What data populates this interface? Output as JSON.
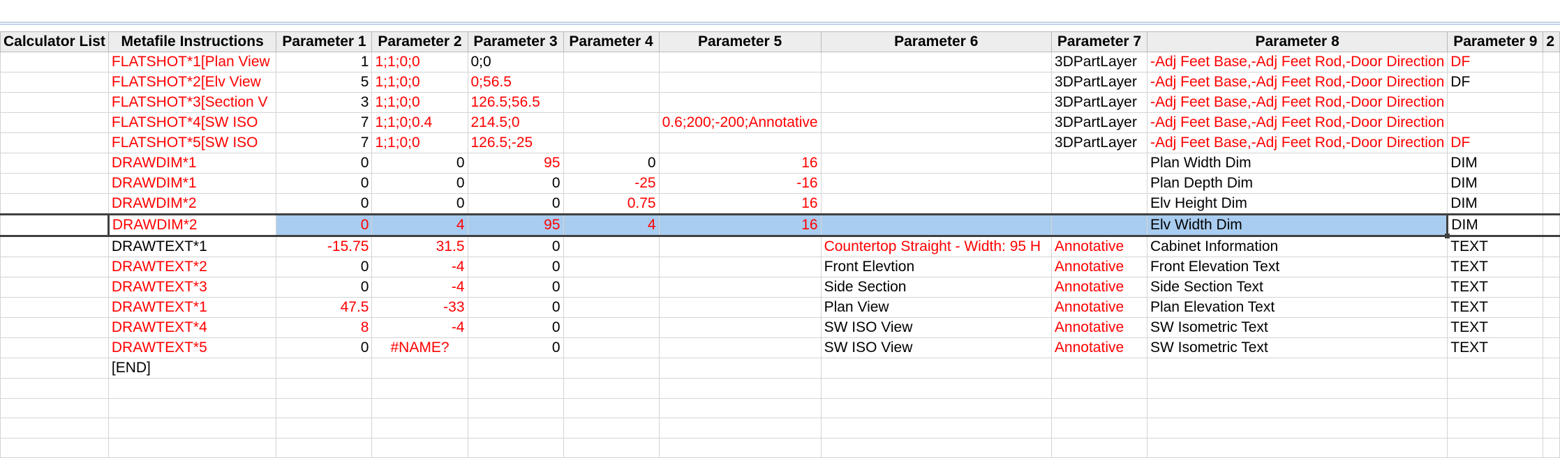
{
  "columns": [
    "Calculator List",
    "Metafile Instructions",
    "Parameter 1",
    "Parameter 2",
    "Parameter 3",
    "Parameter 4",
    "Parameter 5",
    "Parameter 6",
    "Parameter 7",
    "Parameter 8",
    "Parameter 9",
    "2"
  ],
  "rows": [
    {
      "cells": [
        "",
        "FLATSHOT*1[Plan View",
        "1",
        "1;1;0;0",
        "0;0",
        "",
        "",
        "",
        "3DPartLayer",
        "-Adj Feet Base,-Adj Feet Rod,-Door Direction",
        "DF",
        ""
      ],
      "red": [
        1,
        3,
        9,
        10
      ]
    },
    {
      "cells": [
        "",
        "FLATSHOT*2[Elv View",
        "5",
        "1;1;0;0",
        "0;56.5",
        "",
        "",
        "",
        "3DPartLayer",
        "-Adj Feet Base,-Adj Feet Rod,-Door Direction",
        "DF",
        ""
      ],
      "red": [
        1,
        3,
        4,
        9
      ]
    },
    {
      "cells": [
        "",
        "FLATSHOT*3[Section V",
        "3",
        "1;1;0;0",
        "126.5;56.5",
        "",
        "",
        "",
        "3DPartLayer",
        "-Adj Feet Base,-Adj Feet Rod,-Door Direction",
        "",
        ""
      ],
      "red": [
        1,
        3,
        4,
        9
      ]
    },
    {
      "cells": [
        "",
        "FLATSHOT*4[SW ISO",
        "7",
        "1;1;0;0.4",
        "214.5;0",
        "",
        "0.6;200;-200;Annotative",
        "",
        "3DPartLayer",
        "-Adj Feet Base,-Adj Feet Rod,-Door Direction",
        "",
        ""
      ],
      "red": [
        1,
        3,
        4,
        6,
        9
      ]
    },
    {
      "cells": [
        "",
        "FLATSHOT*5[SW ISO",
        "7",
        "1;1;0;0",
        "126.5;-25",
        "",
        "",
        "",
        "3DPartLayer",
        "-Adj Feet Base,-Adj Feet Rod,-Door Direction",
        "DF",
        ""
      ],
      "red": [
        1,
        3,
        4,
        9,
        10
      ]
    },
    {
      "cells": [
        "",
        "DRAWDIM*1",
        "0",
        "0",
        "95",
        "0",
        "16",
        "",
        "",
        "Plan Width Dim",
        "DIM",
        ""
      ],
      "red": [
        1,
        4,
        6
      ]
    },
    {
      "cells": [
        "",
        "DRAWDIM*1",
        "0",
        "0",
        "0",
        "-25",
        "-16",
        "",
        "",
        "Plan Depth Dim",
        "DIM",
        ""
      ],
      "red": [
        1,
        5,
        6
      ]
    },
    {
      "cells": [
        "",
        "DRAWDIM*2",
        "0",
        "0",
        "0",
        "0.75",
        "16",
        "",
        "",
        "Elv Height Dim",
        "DIM",
        ""
      ],
      "red": [
        1,
        5,
        6
      ]
    },
    {
      "cells": [
        "",
        "DRAWDIM*2",
        "0",
        "4",
        "95",
        "4",
        "16",
        "",
        "",
        "Elv Width Dim",
        "DIM",
        ""
      ],
      "red": [
        1,
        2,
        3,
        4,
        5,
        6
      ],
      "selected": true
    },
    {
      "cells": [
        "",
        "DRAWTEXT*1",
        "-15.75",
        "31.5",
        "0",
        "",
        "",
        "Countertop Straight - Width: 95  H",
        "Annotative",
        "Cabinet Information",
        "TEXT",
        ""
      ],
      "red": [
        2,
        3,
        7,
        8
      ]
    },
    {
      "cells": [
        "",
        "DRAWTEXT*2",
        "0",
        "-4",
        "0",
        "",
        "",
        "Front Elevtion",
        "Annotative",
        "Front Elevation Text",
        "TEXT",
        ""
      ],
      "red": [
        1,
        3,
        8
      ]
    },
    {
      "cells": [
        "",
        "DRAWTEXT*3",
        "0",
        "-4",
        "0",
        "",
        "",
        "Side Section",
        "Annotative",
        "Side Section Text",
        "TEXT",
        ""
      ],
      "red": [
        1,
        3,
        8
      ]
    },
    {
      "cells": [
        "",
        "DRAWTEXT*1",
        "47.5",
        "-33",
        "0",
        "",
        "",
        "Plan View",
        "Annotative",
        "Plan Elevation Text",
        "TEXT",
        ""
      ],
      "red": [
        1,
        2,
        3,
        8
      ]
    },
    {
      "cells": [
        "",
        "DRAWTEXT*4",
        "8",
        "-4",
        "0",
        "",
        "",
        "SW ISO View",
        "Annotative",
        "SW Isometric Text",
        "TEXT",
        ""
      ],
      "red": [
        1,
        2,
        3,
        8
      ]
    },
    {
      "cells": [
        "",
        "DRAWTEXT*5",
        "0",
        "#NAME?",
        "0",
        "",
        "",
        "SW ISO View",
        "Annotative",
        "SW Isometric Text",
        "TEXT",
        ""
      ],
      "red": [
        1,
        3,
        8
      ]
    },
    {
      "cells": [
        "",
        "[END]",
        "",
        "",
        "",
        "",
        "",
        "",
        "",
        "",
        "",
        ""
      ],
      "red": []
    },
    {
      "cells": [
        "",
        "",
        "",
        "",
        "",
        "",
        "",
        "",
        "",
        "",
        "",
        ""
      ],
      "red": []
    },
    {
      "cells": [
        "",
        "",
        "",
        "",
        "",
        "",
        "",
        "",
        "",
        "",
        "",
        ""
      ],
      "red": []
    },
    {
      "cells": [
        "",
        "",
        "",
        "",
        "",
        "",
        "",
        "",
        "",
        "",
        "",
        ""
      ],
      "red": []
    },
    {
      "cells": [
        "",
        "",
        "",
        "",
        "",
        "",
        "",
        "",
        "",
        "",
        "",
        ""
      ],
      "red": []
    }
  ],
  "colors": {
    "red_text": "#ff0000",
    "selection": "#a9cdf0",
    "header_bg": "#ededed",
    "grid": "#d4d4d4"
  }
}
